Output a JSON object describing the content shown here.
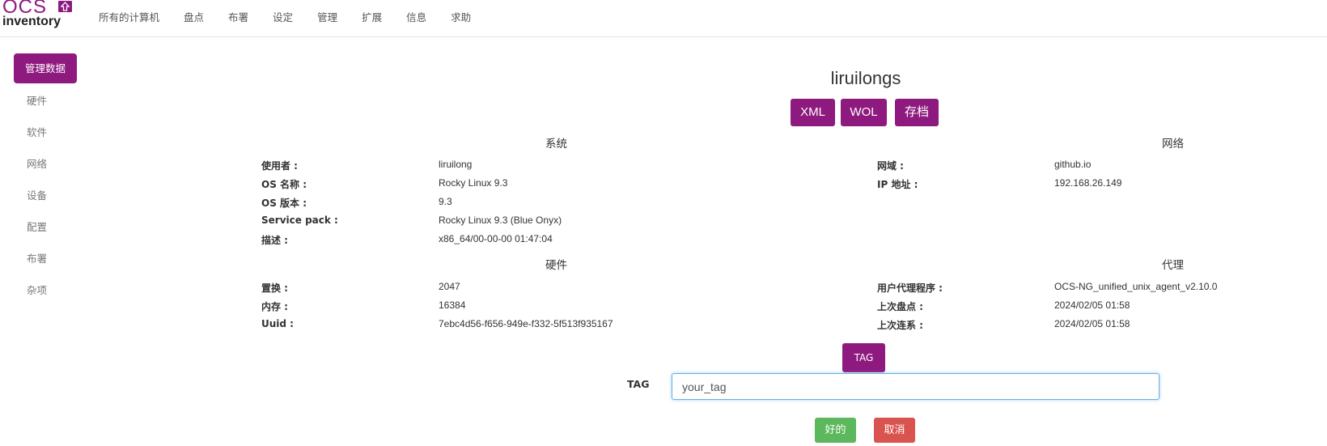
{
  "logo": {
    "top": "OCS",
    "bottom": "inventory"
  },
  "nav": [
    "所有的计算机",
    "盘点",
    "布署",
    "设定",
    "管理",
    "扩展",
    "信息",
    "求助"
  ],
  "sidebar": {
    "active": "管理数据",
    "items": [
      "硬件",
      "软件",
      "网络",
      "设备",
      "配置",
      "布署",
      "杂项"
    ]
  },
  "computer": {
    "name": "liruilongs",
    "buttons": {
      "xml": "XML",
      "wol": "WOL",
      "archive": "存档"
    }
  },
  "system": {
    "title": "系统",
    "rows": [
      {
        "label": "使用者 :",
        "value": "liruilong"
      },
      {
        "label": "OS 名称 :",
        "value": "Rocky Linux 9.3"
      },
      {
        "label": "OS 版本 :",
        "value": "9.3"
      },
      {
        "label": "Service pack :",
        "value": "Rocky Linux 9.3 (Blue Onyx)"
      },
      {
        "label": "描述 :",
        "value": "x86_64/00-00-00 01:47:04"
      }
    ]
  },
  "network": {
    "title": "网络",
    "rows": [
      {
        "label": "网域 :",
        "value": "github.io"
      },
      {
        "label": "IP 地址 :",
        "value": "192.168.26.149"
      }
    ]
  },
  "hardware": {
    "title": "硬件",
    "rows": [
      {
        "label": "置换 :",
        "value": "2047"
      },
      {
        "label": "内存 :",
        "value": "16384"
      },
      {
        "label": "Uuid :",
        "value": "7ebc4d56-f656-949e-f332-5f513f935167"
      }
    ]
  },
  "agent": {
    "title": "代理",
    "rows": [
      {
        "label": "用户代理程序 :",
        "value": "OCS-NG_unified_unix_agent_v2.10.0"
      },
      {
        "label": "上次盘点 :",
        "value": "2024/02/05 01:58"
      },
      {
        "label": "上次连系 :",
        "value": "2024/02/05 01:58"
      }
    ]
  },
  "tag": {
    "button": "TAG",
    "label": "TAG",
    "value": "your_tag",
    "ok": "好的",
    "cancel": "取消"
  },
  "colors": {
    "brand": "#8e1a7f",
    "ok": "#5cb85c",
    "cancel": "#d9534f"
  }
}
